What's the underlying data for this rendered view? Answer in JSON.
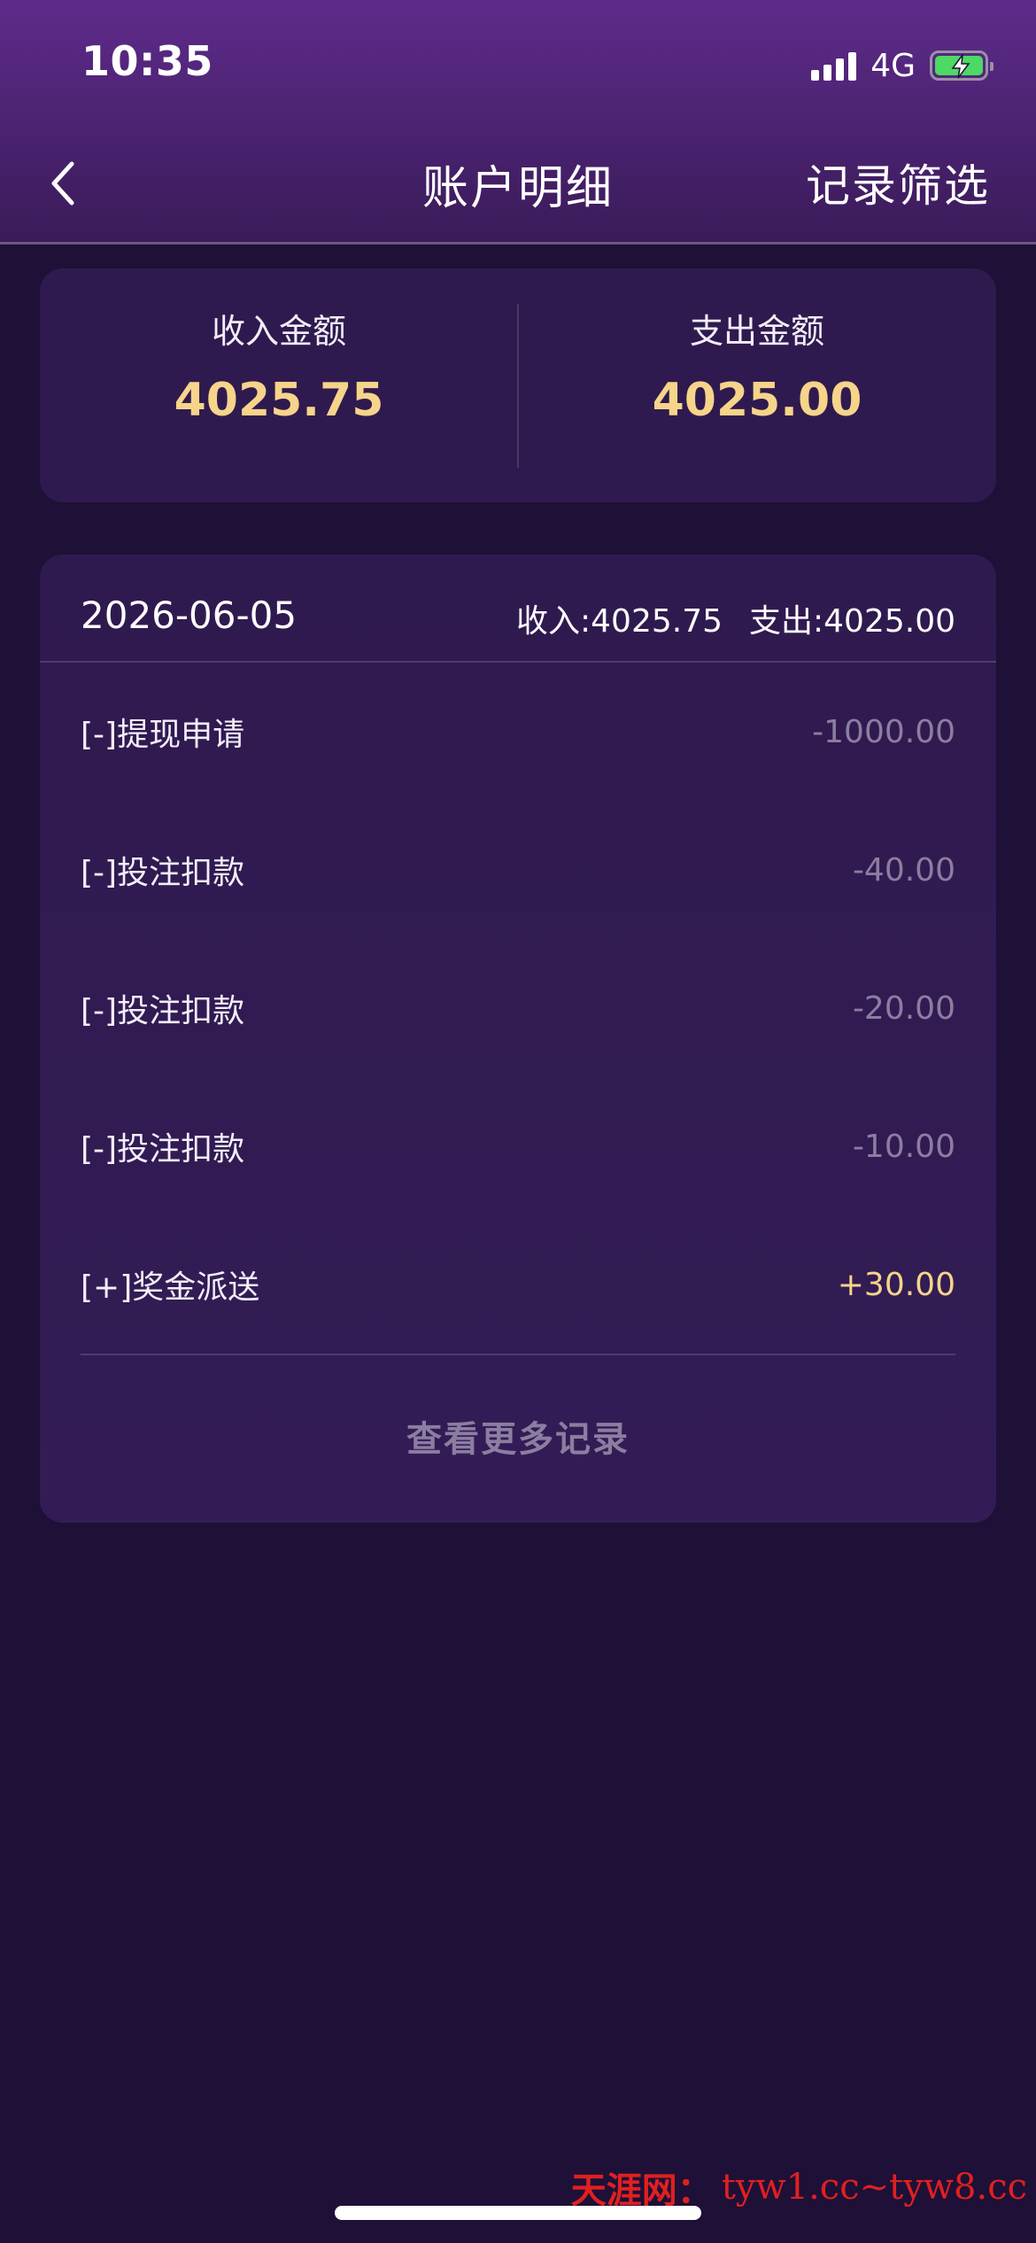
{
  "status_bar": {
    "time": "10:35",
    "network": "4G"
  },
  "nav": {
    "title": "账户明细",
    "filter_label": "记录筛选"
  },
  "summary": {
    "income_label": "收入金额",
    "income_value": "4025.75",
    "expense_label": "支出金额",
    "expense_value": "4025.00"
  },
  "records": {
    "date": "2026-06-05",
    "income_summary": "收入:4025.75",
    "expense_summary": "支出:4025.00",
    "items": [
      {
        "name": "[-]提现申请",
        "amount": "-1000.00"
      },
      {
        "name": "[-]投注扣款",
        "amount": "-40.00"
      },
      {
        "name": "[-]投注扣款",
        "amount": "-20.00"
      },
      {
        "name": "[-]投注扣款",
        "amount": "-10.00"
      },
      {
        "name": "[+]奖金派送",
        "amount": "+30.00"
      }
    ],
    "more_label": "查看更多记录"
  },
  "watermark": {
    "brand": "天涯网：",
    "url": "tyw1.cc~tyw8.cc"
  },
  "colors": {
    "background": "#1e1037",
    "card": "#2f1a4f",
    "accent_gold": "#f6d48a",
    "muted": "#8b7ea0"
  }
}
